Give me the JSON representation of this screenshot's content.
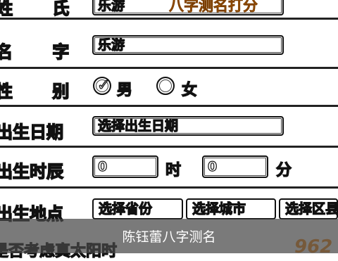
{
  "form": {
    "surname_label": "姓  氏",
    "surname_value": "乐游",
    "banner_text": "八字测名打分",
    "name_label": "名  字",
    "name_value": "乐游",
    "gender_label": "性  别",
    "gender_male": "男",
    "gender_female": "女",
    "gender_selected": "男",
    "birth_date_label": "出生日期",
    "birth_date_value": "选择出生日期",
    "birth_time_label": "出生时辰",
    "hour_value": "0",
    "hour_unit": "时",
    "minute_value": "0",
    "minute_unit": "分",
    "birth_place_label": "出生地点",
    "province_select": "选择省份",
    "city_select": "选择城市",
    "district_select": "选择区县",
    "solar_time_label": "是否考虑真太阳时"
  },
  "overlay": {
    "caption": "陈钰蕾八字测名"
  },
  "logo": {
    "text": "962",
    "color": "#f08a1c"
  },
  "colors": {
    "outline": "#111111",
    "background": "#ffffff",
    "caption_bar": "#464646"
  }
}
